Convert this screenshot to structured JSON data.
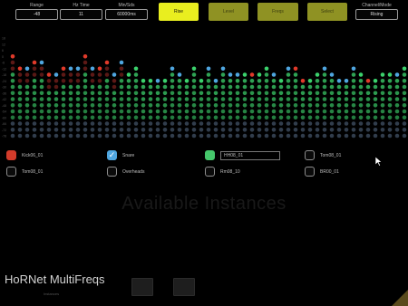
{
  "controls": [
    {
      "label": "Range",
      "value": "-48"
    },
    {
      "label": "Hz Time",
      "value": "11"
    },
    {
      "label": "Min/Sds",
      "value": "60000ms"
    }
  ],
  "toggles": [
    {
      "label": "Rise",
      "active": true
    },
    {
      "label": "Level",
      "active": false
    },
    {
      "label": "Freqs",
      "active": false
    },
    {
      "label": "Select",
      "active": false
    }
  ],
  "mode": {
    "label": "Channel/Mode",
    "value": "Rising"
  },
  "meters": {
    "row_labels": [
      "18",
      "12",
      "6",
      "0",
      "-6",
      "-12",
      "-18",
      "-24",
      "-30",
      "-36",
      "-42",
      "-48",
      "-54",
      "-60",
      "-66",
      "-72",
      "-78"
    ],
    "bands": 55
  },
  "tracks": [
    {
      "name": "Kick06_01",
      "color": "#d23b2a",
      "checked": false,
      "filled": true
    },
    {
      "name": "Snare",
      "color": "#4fa6e0",
      "checked": true,
      "filled": true
    },
    {
      "name": "HH08_01",
      "color": "#45c76b",
      "checked": false,
      "filled": true
    },
    {
      "name": "Tom08_01",
      "color": "#444444",
      "checked": false,
      "filled": false
    },
    {
      "name": "Tom08_01",
      "color": "#444444",
      "checked": false,
      "filled": false
    },
    {
      "name": "Overheads",
      "color": "#444444",
      "checked": false,
      "filled": false
    },
    {
      "name": "Rm08_10",
      "color": "#444444",
      "checked": false,
      "filled": false
    },
    {
      "name": "BR00_01",
      "color": "#444444",
      "checked": false,
      "filled": false
    }
  ],
  "check_glyph": "✓",
  "watermark": "Available Instances",
  "brand": "HoRNet MultiFreqs",
  "brand_sub": "Instances"
}
